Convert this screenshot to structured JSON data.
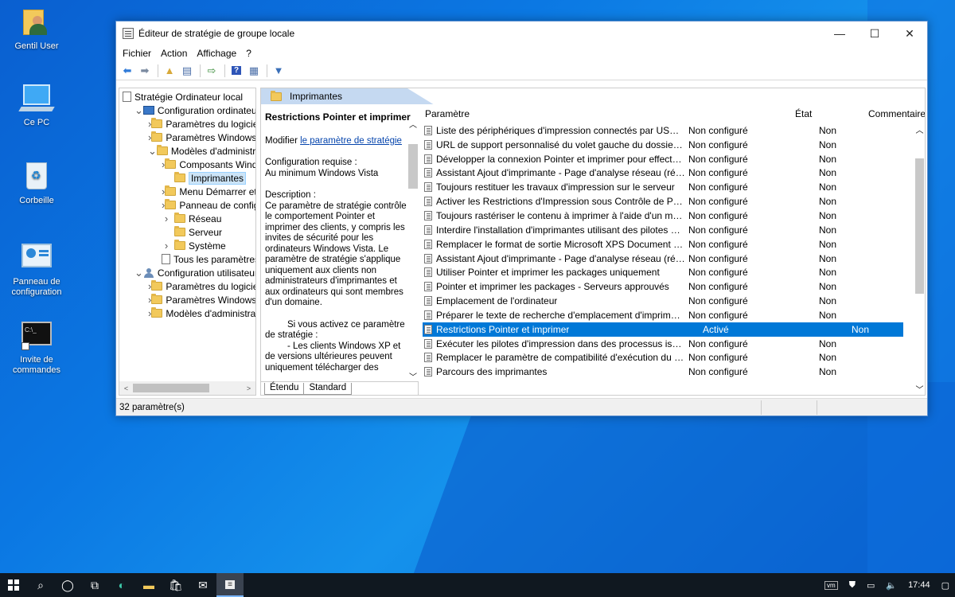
{
  "desktop": {
    "icons": [
      {
        "label": "Gentil User"
      },
      {
        "label": "Ce PC"
      },
      {
        "label": "Corbeille"
      },
      {
        "label": "Panneau de configuration"
      },
      {
        "label": "Invite de commandes"
      }
    ]
  },
  "window": {
    "title": "Éditeur de stratégie de groupe locale",
    "controls": {
      "minimize": "—",
      "maximize": "☐",
      "close": "✕"
    },
    "menu": [
      "Fichier",
      "Action",
      "Affichage",
      "?"
    ]
  },
  "tree": {
    "items": [
      {
        "label": "Stratégie Ordinateur local",
        "level": 0,
        "icon": "document"
      },
      {
        "label": "Configuration ordinateur",
        "level": 1,
        "icon": "computer",
        "chevron": "down"
      },
      {
        "label": "Paramètres du logiciel",
        "level": 2,
        "icon": "folder",
        "chevron": "right"
      },
      {
        "label": "Paramètres Windows",
        "level": 2,
        "icon": "folder",
        "chevron": "right"
      },
      {
        "label": "Modèles d'administrat",
        "level": 2,
        "icon": "folder",
        "chevron": "down"
      },
      {
        "label": "Composants Windo",
        "level": 3,
        "icon": "folder",
        "chevron": "right"
      },
      {
        "label": "Imprimantes",
        "level": 3,
        "icon": "folder",
        "selected": true
      },
      {
        "label": "Menu Démarrer et",
        "level": 3,
        "icon": "folder",
        "chevron": "right"
      },
      {
        "label": "Panneau de config",
        "level": 3,
        "icon": "folder",
        "chevron": "right"
      },
      {
        "label": "Réseau",
        "level": 3,
        "icon": "folder",
        "chevron": "right"
      },
      {
        "label": "Serveur",
        "level": 3,
        "icon": "folder"
      },
      {
        "label": "Système",
        "level": 3,
        "icon": "folder",
        "chevron": "right"
      },
      {
        "label": "Tous les paramètres",
        "level": 3,
        "icon": "document"
      },
      {
        "label": "Configuration utilisateur",
        "level": 1,
        "icon": "user",
        "chevron": "down"
      },
      {
        "label": "Paramètres du logiciel",
        "level": 2,
        "icon": "folder",
        "chevron": "right"
      },
      {
        "label": "Paramètres Windows",
        "level": 2,
        "icon": "folder",
        "chevron": "right"
      },
      {
        "label": "Modèles d'administrat",
        "level": 2,
        "icon": "folder",
        "chevron": "right"
      }
    ]
  },
  "panel": {
    "header": "Imprimantes",
    "desc_title": "Restrictions Pointer et imprimer",
    "modify_prefix": "Modifier ",
    "modify_link": "le paramètre de stratégie",
    "requirements_label": "Configuration requise :",
    "requirements_value": "Au minimum Windows Vista",
    "description_label": "Description :",
    "description_text": "Ce paramètre de stratégie contrôle le comportement Pointer et imprimer des clients, y compris les invites de sécurité pour les ordinateurs Windows Vista. Le paramètre de stratégie s'applique uniquement aux clients non administrateurs d'imprimantes et aux ordinateurs qui sont membres d'un domaine.",
    "description_text2": "Si vous activez ce paramètre de stratégie :",
    "description_text3": "- Les clients Windows XP et de versions ultérieures peuvent uniquement télécharger des",
    "tabs": [
      "Étendu",
      "Standard"
    ]
  },
  "list": {
    "columns": {
      "name": "Paramètre",
      "state": "État",
      "comment": "Commentaire"
    },
    "rows": [
      {
        "name": "Liste des périphériques d'impression connectés par USB app...",
        "state": "Non configuré",
        "comment": "Non"
      },
      {
        "name": "URL de support personnalisé du volet gauche du dossier Im...",
        "state": "Non configuré",
        "comment": "Non"
      },
      {
        "name": "Développer la connexion Pointer et imprimer pour effectuer...",
        "state": "Non configuré",
        "comment": "Non"
      },
      {
        "name": "Assistant Ajout d'imprimante - Page d'analyse réseau (résea...",
        "state": "Non configuré",
        "comment": "Non"
      },
      {
        "name": "Toujours restituer les travaux d'impression sur le serveur",
        "state": "Non configuré",
        "comment": "Non"
      },
      {
        "name": "Activer les Restrictions d'Impression sous Contrôle de Périp...",
        "state": "Non configuré",
        "comment": "Non"
      },
      {
        "name": "Toujours rastériser le contenu à imprimer à l'aide d'un modu...",
        "state": "Non configuré",
        "comment": "Non"
      },
      {
        "name": "Interdire l'installation d'imprimantes utilisant des pilotes en ...",
        "state": "Non configuré",
        "comment": "Non"
      },
      {
        "name": "Remplacer le format de sortie Microsoft XPS Document Writ...",
        "state": "Non configuré",
        "comment": "Non"
      },
      {
        "name": "Assistant Ajout d'imprimante - Page d'analyse réseau (résea...",
        "state": "Non configuré",
        "comment": "Non"
      },
      {
        "name": "Utiliser Pointer et imprimer les packages uniquement",
        "state": "Non configuré",
        "comment": "Non"
      },
      {
        "name": "Pointer et imprimer les packages - Serveurs approuvés",
        "state": "Non configuré",
        "comment": "Non"
      },
      {
        "name": "Emplacement de l'ordinateur",
        "state": "Non configuré",
        "comment": "Non"
      },
      {
        "name": "Préparer le texte de recherche d'emplacement d'imprimante",
        "state": "Non configuré",
        "comment": "Non"
      },
      {
        "name": "Restrictions Pointer et imprimer",
        "state": "Activé",
        "comment": "Non",
        "selected": true
      },
      {
        "name": "Exécuter les pilotes d'impression dans des processus isolés",
        "state": "Non configuré",
        "comment": "Non"
      },
      {
        "name": "Remplacer le paramètre de compatibilité d'exécution du pil...",
        "state": "Non configuré",
        "comment": "Non"
      },
      {
        "name": "Parcours des imprimantes",
        "state": "Non configuré",
        "comment": "Non"
      }
    ]
  },
  "status": {
    "text": "32 paramètre(s)"
  },
  "taskbar": {
    "items": [
      "start-icon",
      "search-icon",
      "cortana-icon",
      "task-view-icon",
      "edge-icon",
      "explorer-icon",
      "store-icon",
      "mail-icon",
      "gpedit-icon"
    ],
    "time": "17:44"
  }
}
